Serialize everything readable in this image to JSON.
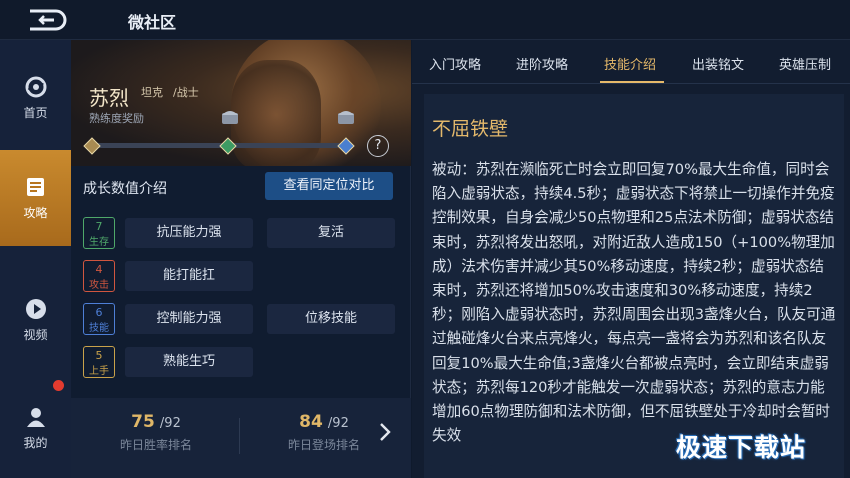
{
  "header": {
    "title": "微社区",
    "back_icon": "back-arrow-icon"
  },
  "sidebar": {
    "items": [
      {
        "label": "首页",
        "icon": "home-swirl-icon",
        "active": false
      },
      {
        "label": "攻略",
        "icon": "guide-doc-icon",
        "active": true
      },
      {
        "label": "视频",
        "icon": "video-play-icon",
        "active": false
      },
      {
        "label": "我的",
        "icon": "user-icon",
        "active": false
      }
    ],
    "notification_dot_color": "#e33b2f"
  },
  "hero": {
    "name": "苏烈",
    "role_primary": "坦克",
    "role_secondary": "/战士",
    "subtitle": "熟练度奖励",
    "proficiency_progress": 0.02,
    "help_label": "?"
  },
  "growth": {
    "title": "成长数值介绍",
    "compare_button": "查看同定位对比",
    "rows": [
      {
        "level": "7",
        "kind": "生存",
        "color": "#4fa86a",
        "tags": [
          "抗压能力强",
          "复活"
        ]
      },
      {
        "level": "4",
        "kind": "攻击",
        "color": "#d0563f",
        "tags": [
          "能打能扛"
        ]
      },
      {
        "level": "6",
        "kind": "技能",
        "color": "#4e7fd6",
        "tags": [
          "控制能力强",
          "位移技能"
        ]
      },
      {
        "level": "5",
        "kind": "上手",
        "color": "#c9a24a",
        "tags": [
          "熟能生巧"
        ]
      }
    ]
  },
  "stats": {
    "win_rank": {
      "value": "75",
      "total": "/92",
      "label": "昨日胜率排名"
    },
    "appearance_rank": {
      "value": "84",
      "total": "/92",
      "label": "昨日登场排名"
    }
  },
  "tabs": [
    "入门攻略",
    "进阶攻略",
    "技能介绍",
    "出装铭文",
    "英雄压制"
  ],
  "active_tab": "技能介绍",
  "skill": {
    "name": "不屈铁壁",
    "description": "被动：苏烈在濒临死亡时会立即回复70%最大生命值，同时会陷入虚弱状态，持续4.5秒；虚弱状态下将禁止一切操作并免疫控制效果，自身会减少50点物理和25点法术防御；虚弱状态结束时，苏烈将发出怒吼，对附近敌人造成150（+100%物理加成）法术伤害并减少其50%移动速度，持续2秒；虚弱状态结束时，苏烈还将增加50%攻击速度和30%移动速度，持续2秒；刚陷入虚弱状态时，苏烈周围会出现3盏烽火台，队友可通过触碰烽火台来点亮烽火，每点亮一盏将会为苏烈和该名队友回复10%最大生命值;3盏烽火台都被点亮时，会立即结束虚弱状态；苏烈每120秒才能触发一次虚弱状态；苏烈的意志力能增加60点物理防御和法术防御，但不屈铁壁处于冷却时会暂时失效"
  },
  "watermark": "极速下载站",
  "colors": {
    "accent_gold": "#e5b96a",
    "active_nav": "#c98a2e",
    "compare_btn": "#1d4e86"
  }
}
